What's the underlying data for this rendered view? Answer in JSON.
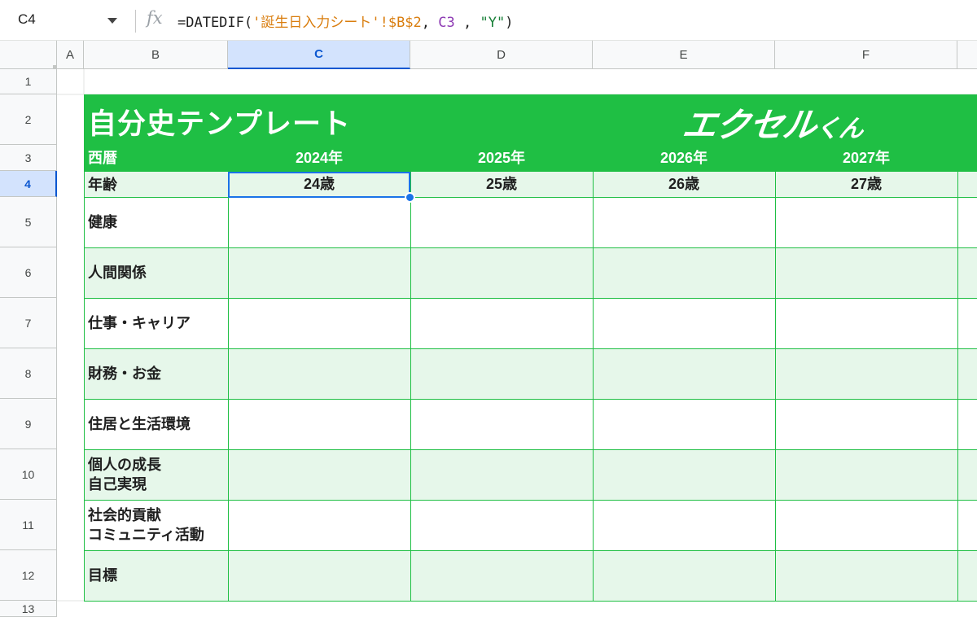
{
  "formula_bar": {
    "cell_ref": "C4",
    "fx_symbol": "fx",
    "formula_parts": [
      {
        "text": "=DATEDIF(",
        "kind": "base"
      },
      {
        "text": "'誕生日入力シート'!$B$2",
        "kind": "str"
      },
      {
        "text": ", ",
        "kind": "base"
      },
      {
        "text": "C3",
        "kind": "ref"
      },
      {
        "text": " , ",
        "kind": "base"
      },
      {
        "text": "\"Y\"",
        "kind": "lit"
      },
      {
        "text": ")",
        "kind": "base"
      }
    ]
  },
  "columns": [
    "A",
    "B",
    "C",
    "D",
    "E",
    "F"
  ],
  "selected_column": "C",
  "rows": [
    "1",
    "2",
    "3",
    "4",
    "5",
    "6",
    "7",
    "8",
    "9",
    "10",
    "11",
    "12",
    "13"
  ],
  "selected_row": "4",
  "template": {
    "title": "自分史テンプレート",
    "brand": {
      "main": "エクセル",
      "small": "くん"
    },
    "year_label": "西暦",
    "years": [
      "2024年",
      "2025年",
      "2026年",
      "2027年"
    ],
    "age_label": "年齢",
    "ages": [
      "24歳",
      "25歳",
      "26歳",
      "27歳"
    ],
    "categories": [
      "健康",
      "人間関係",
      "仕事・キャリア",
      "財務・お金",
      "住居と生活環境",
      "個人の成長\n自己実現",
      "社会的貢献\nコミュニティ活動",
      "目標"
    ]
  },
  "colors": {
    "accent_green": "#1fbf44",
    "light_green": "#e6f7ea",
    "selection_blue": "#1a73e8"
  }
}
